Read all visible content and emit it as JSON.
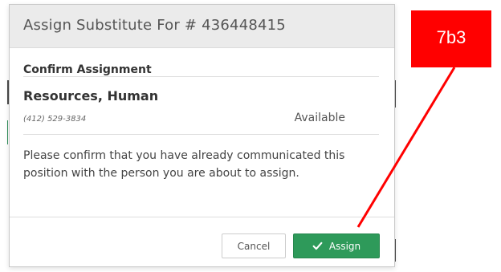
{
  "modal": {
    "title": "Assign Substitute For # 436448415",
    "section_title": "Confirm Assignment",
    "person": {
      "name": "Resources, Human",
      "phone": "(412) 529-3834",
      "status": "Available"
    },
    "message": "Please confirm that you have already communicated this position with the person you are about to assign.",
    "buttons": {
      "cancel_label": "Cancel",
      "assign_label": "Assign"
    }
  },
  "annotation": {
    "label": "7b3",
    "color": "#ff0000"
  },
  "colors": {
    "assign_button": "#2e9a5a",
    "header_bg": "#ebebeb"
  },
  "icons": {
    "assign_button": "check-icon"
  }
}
